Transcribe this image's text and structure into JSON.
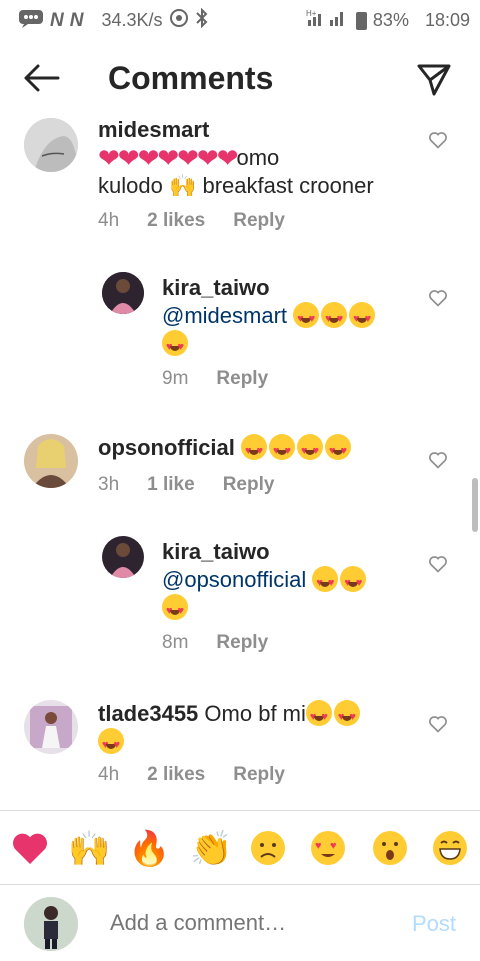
{
  "status_bar": {
    "speed": "34.3K/s",
    "battery": "83%",
    "time": "18:09",
    "network_badge": "H+"
  },
  "header": {
    "title": "Comments"
  },
  "comments": [
    {
      "username": "midesmart",
      "text_after": "omo",
      "text_line2": "kulodo",
      "text_line2b": "breakfast crooner",
      "age": "4h",
      "likes": "2 likes",
      "reply": "Reply"
    },
    {
      "username": "kira_taiwo",
      "mention": "@midesmart",
      "age": "9m",
      "reply": "Reply"
    },
    {
      "username": "opsonofficial",
      "age": "3h",
      "likes": "1 like",
      "reply": "Reply"
    },
    {
      "username": "kira_taiwo",
      "mention": "@opsonofficial",
      "age": "8m",
      "reply": "Reply"
    },
    {
      "username": "tlade3455",
      "text": "Omo bf mi",
      "age": "4h",
      "likes": "2 likes",
      "reply": "Reply"
    }
  ],
  "reactions": [
    "heart",
    "raised-hands",
    "fire",
    "clapping-hands",
    "sad-face",
    "heart-eyes",
    "surprised-face",
    "grinning-face"
  ],
  "composer": {
    "placeholder": "Add a comment…",
    "post": "Post"
  },
  "colors": {
    "mention": "#003569",
    "meta": "#8e8e8e",
    "post_disabled": "#b3dbff",
    "heart_pink": "#e8346c"
  }
}
